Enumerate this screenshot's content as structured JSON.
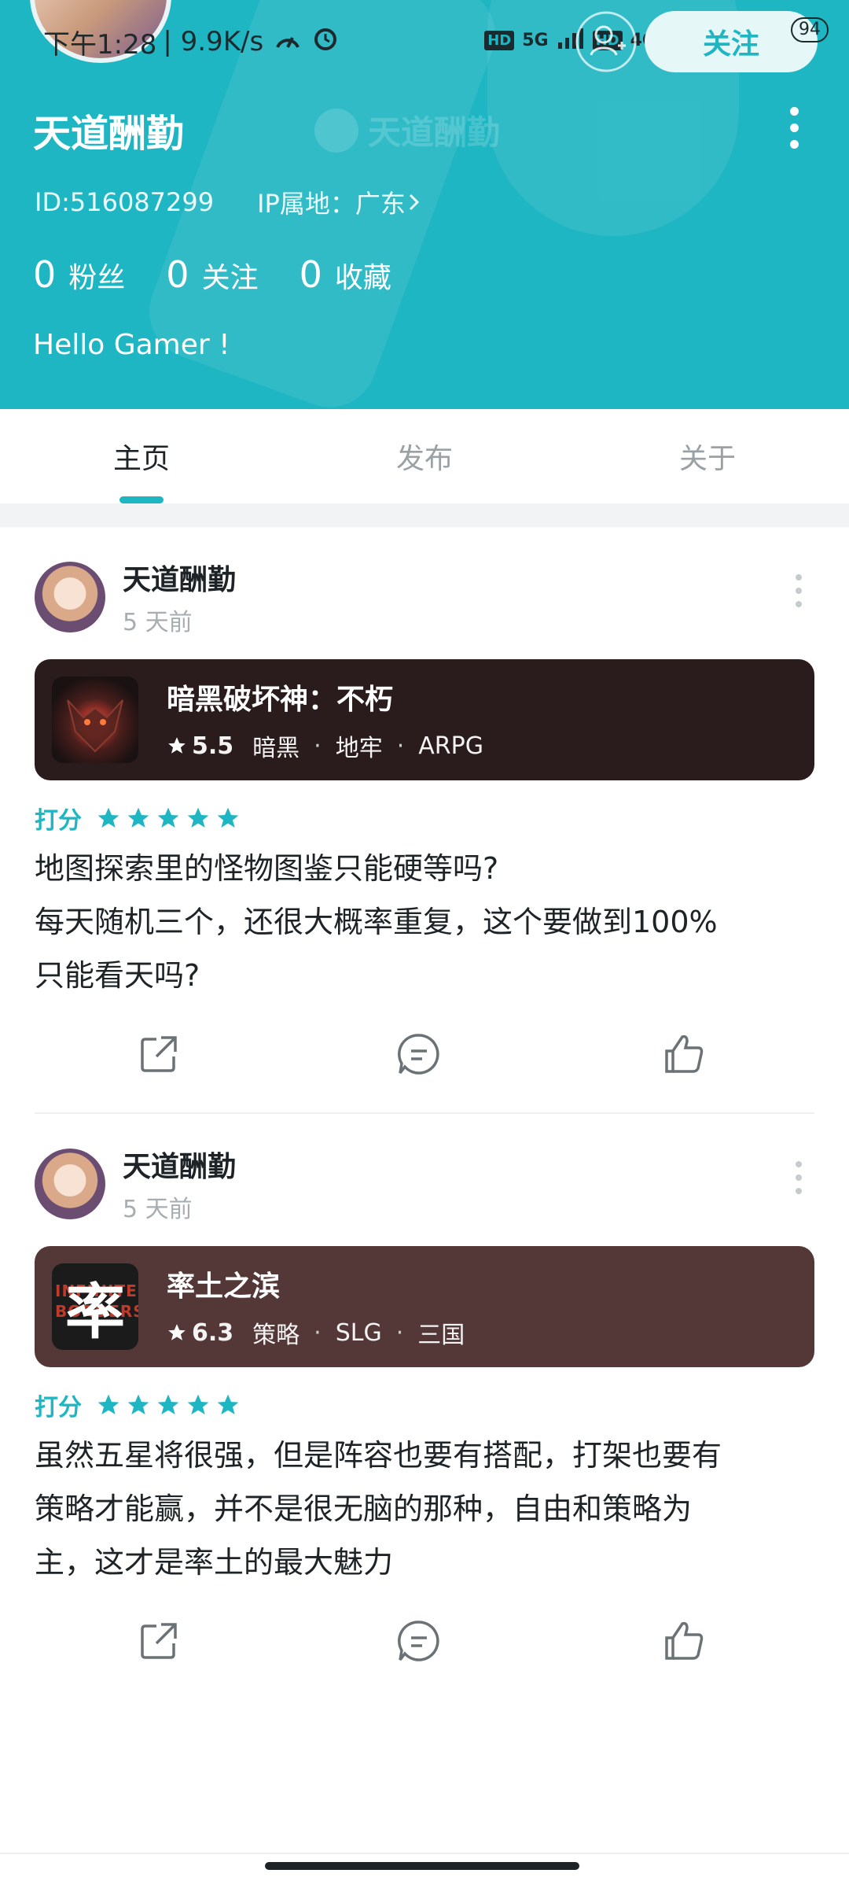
{
  "status_bar": {
    "time": "下午1:28",
    "speed": "| 9.9K/s",
    "net1": "5G",
    "net2": "4G",
    "hd": "HD",
    "battery": "94"
  },
  "profile": {
    "name": "天道酬勤",
    "watermark": "天道酬勤",
    "follow_label": "关注",
    "id_text": "ID:516087299",
    "ip_text": "IP属地：广东",
    "stats": [
      {
        "num": "0",
        "label": "粉丝"
      },
      {
        "num": "0",
        "label": "关注"
      },
      {
        "num": "0",
        "label": "收藏"
      }
    ],
    "bio": "Hello Gamer !"
  },
  "tabs": [
    {
      "label": "主页",
      "active": true
    },
    {
      "label": "发布",
      "active": false
    },
    {
      "label": "关于",
      "active": false
    }
  ],
  "posts": [
    {
      "user": "天道酬勤",
      "time": "5 天前",
      "game": {
        "title": "暗黑破坏神：不朽",
        "score": "5.5",
        "tags": [
          "暗黑",
          "地牢",
          "ARPG"
        ],
        "bg": "#2a1b1d"
      },
      "rating_label": "打分",
      "stars": 5,
      "text_lines": [
        "地图探索里的怪物图鉴只能硬等吗?",
        "每天随机三个，还很大概率重复，这个要做到100%",
        "只能看天吗?"
      ]
    },
    {
      "user": "天道酬勤",
      "time": "5 天前",
      "game": {
        "title": "率土之滨",
        "score": "6.3",
        "tags": [
          "策略",
          "SLG",
          "三国"
        ],
        "bg": "#543737",
        "icon_char": "率",
        "icon_text": "INFINITE BORDERS"
      },
      "rating_label": "打分",
      "stars": 5,
      "text_lines": [
        "虽然五星将很强，但是阵容也要有搭配，打架也要有",
        "策略才能赢，并不是很无脑的那种，自由和策略为",
        "主，这才是率土的最大魅力"
      ]
    }
  ],
  "colors": {
    "accent": "#1fb6c3",
    "text": "#1d2326",
    "muted": "#a7adb0"
  },
  "icons": {
    "share": "share-icon",
    "comment": "comment-icon",
    "like": "like-icon",
    "more": "more-vertical-icon",
    "add_user": "add-user-icon",
    "star": "star-icon"
  }
}
